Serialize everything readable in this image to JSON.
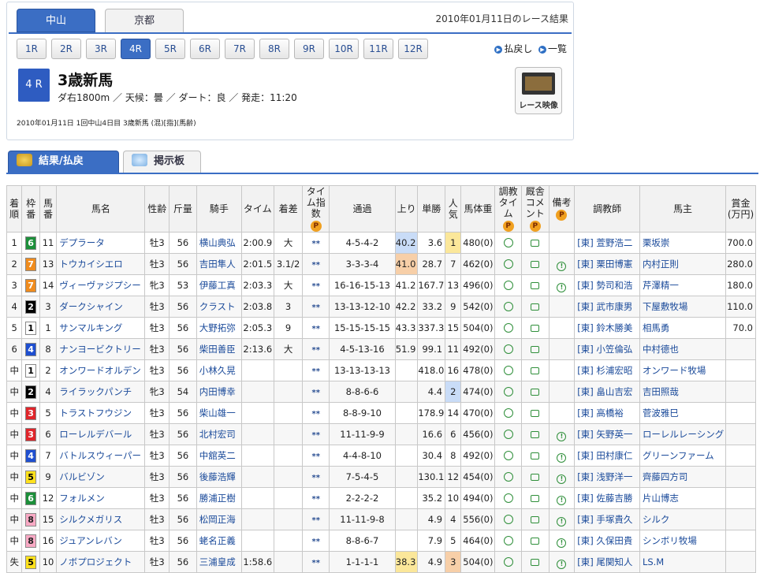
{
  "venues": [
    "中山",
    "京都"
  ],
  "result_date": "2010年01月11日のレース結果",
  "races": [
    "1R",
    "2R",
    "3R",
    "4R",
    "5R",
    "6R",
    "7R",
    "8R",
    "9R",
    "10R",
    "11R",
    "12R"
  ],
  "links": {
    "payout": "払戻し",
    "list": "一覧"
  },
  "race": {
    "no": "4 R",
    "name": "3歳新馬",
    "info": "ダ右1800m ／ 天候：曇 ／ ダート：良 ／ 発走：11:20",
    "full": "2010年01月11日 1回中山4日目 3歳新馬 (混)[指](馬齢)",
    "video": "レース映像"
  },
  "tabs": {
    "result": "結果/払戻",
    "bbs": "掲示板"
  },
  "headers": [
    "着順",
    "枠番",
    "馬番",
    "馬名",
    "性齢",
    "斤量",
    "騎手",
    "タイム",
    "着差",
    "タイム指数",
    "通過",
    "上り",
    "単勝",
    "人気",
    "馬体重",
    "調教タイム",
    "厩舎コメント",
    "備考",
    "調教師",
    "馬主",
    "賞金(万円)"
  ],
  "rows": [
    [
      "1",
      "6",
      "11",
      "デプラータ",
      "牡3",
      "56",
      "横山典弘",
      "2:00.9",
      "大",
      "**",
      "4-5-4-2",
      "40.2",
      "3.6",
      "1",
      "480(0)",
      "[東] 萱野浩二",
      "栗坂崇",
      "700.0"
    ],
    [
      "2",
      "7",
      "13",
      "トウカイシエロ",
      "牡3",
      "56",
      "吉田隼人",
      "2:01.5",
      "3.1/2",
      "**",
      "3-3-3-4",
      "41.0",
      "28.7",
      "7",
      "462(0)",
      "[東] 栗田博憲",
      "内村正則",
      "280.0"
    ],
    [
      "3",
      "7",
      "14",
      "ヴィーヴァジプシー",
      "牝3",
      "53",
      "伊藤工真",
      "2:03.3",
      "大",
      "**",
      "16-16-15-13",
      "41.2",
      "167.7",
      "13",
      "496(0)",
      "[東] 勢司和浩",
      "芹澤精一",
      "180.0"
    ],
    [
      "4",
      "2",
      "3",
      "ダークシャイン",
      "牡3",
      "56",
      "クラスト",
      "2:03.8",
      "3",
      "**",
      "13-13-12-10",
      "42.2",
      "33.2",
      "9",
      "542(0)",
      "[東] 武市康男",
      "下屋敷牧場",
      "110.0"
    ],
    [
      "5",
      "1",
      "1",
      "サンマルキング",
      "牡3",
      "56",
      "大野拓弥",
      "2:05.3",
      "9",
      "**",
      "15-15-15-15",
      "43.3",
      "337.3",
      "15",
      "504(0)",
      "[東] 鈴木勝美",
      "相馬勇",
      "70.0"
    ],
    [
      "6",
      "4",
      "8",
      "ナンヨービクトリー",
      "牡3",
      "56",
      "柴田善臣",
      "2:13.6",
      "大",
      "**",
      "4-5-13-16",
      "51.9",
      "99.1",
      "11",
      "492(0)",
      "[東] 小笠倫弘",
      "中村德也",
      ""
    ],
    [
      "中",
      "1",
      "2",
      "オンワードオルデン",
      "牡3",
      "56",
      "小林久晃",
      "",
      "",
      "**",
      "13-13-13-13",
      "",
      "418.0",
      "16",
      "478(0)",
      "[東] 杉浦宏昭",
      "オンワード牧場",
      ""
    ],
    [
      "中",
      "2",
      "4",
      "ライラックパンチ",
      "牝3",
      "54",
      "内田博幸",
      "",
      "",
      "**",
      "8-8-6-6",
      "",
      "4.4",
      "2",
      "474(0)",
      "[東] 畠山吉宏",
      "吉田照哉",
      ""
    ],
    [
      "中",
      "3",
      "5",
      "トラストフウジン",
      "牡3",
      "56",
      "柴山雄一",
      "",
      "",
      "**",
      "8-8-9-10",
      "",
      "178.9",
      "14",
      "470(0)",
      "[東] 高橋裕",
      "菅波雅巳",
      ""
    ],
    [
      "中",
      "3",
      "6",
      "ローレルデバール",
      "牡3",
      "56",
      "北村宏司",
      "",
      "",
      "**",
      "11-11-9-9",
      "",
      "16.6",
      "6",
      "456(0)",
      "[東] 矢野英一",
      "ローレルレーシング",
      ""
    ],
    [
      "中",
      "4",
      "7",
      "バトルスウィーパー",
      "牡3",
      "56",
      "中舘英二",
      "",
      "",
      "**",
      "4-4-8-10",
      "",
      "30.4",
      "8",
      "492(0)",
      "[東] 田村康仁",
      "グリーンファーム",
      ""
    ],
    [
      "中",
      "5",
      "9",
      "バルビゾン",
      "牡3",
      "56",
      "後藤浩輝",
      "",
      "",
      "**",
      "7-5-4-5",
      "",
      "130.1",
      "12",
      "454(0)",
      "[東] 浅野洋一",
      "齊藤四方司",
      ""
    ],
    [
      "中",
      "6",
      "12",
      "フォルメン",
      "牡3",
      "56",
      "勝浦正樹",
      "",
      "",
      "**",
      "2-2-2-2",
      "",
      "35.2",
      "10",
      "494(0)",
      "[東] 佐藤吉勝",
      "片山博志",
      ""
    ],
    [
      "中",
      "8",
      "15",
      "シルクメガリス",
      "牡3",
      "56",
      "松岡正海",
      "",
      "",
      "**",
      "11-11-9-8",
      "",
      "4.9",
      "4",
      "556(0)",
      "[東] 手塚貴久",
      "シルク",
      ""
    ],
    [
      "中",
      "8",
      "16",
      "ジュアンレバン",
      "牡3",
      "56",
      "蛯名正義",
      "",
      "",
      "**",
      "8-8-6-7",
      "",
      "7.9",
      "5",
      "464(0)",
      "[東] 久保田貴",
      "シンボリ牧場",
      ""
    ],
    [
      "失",
      "5",
      "10",
      "ノボプロジェクト",
      "牡3",
      "56",
      "三浦皇成",
      "1:58.6",
      "",
      "**",
      "1-1-1-1",
      "38.3",
      "4.9",
      "3",
      "504(0)",
      "[東] 尾関知人",
      "LS.M",
      ""
    ]
  ]
}
